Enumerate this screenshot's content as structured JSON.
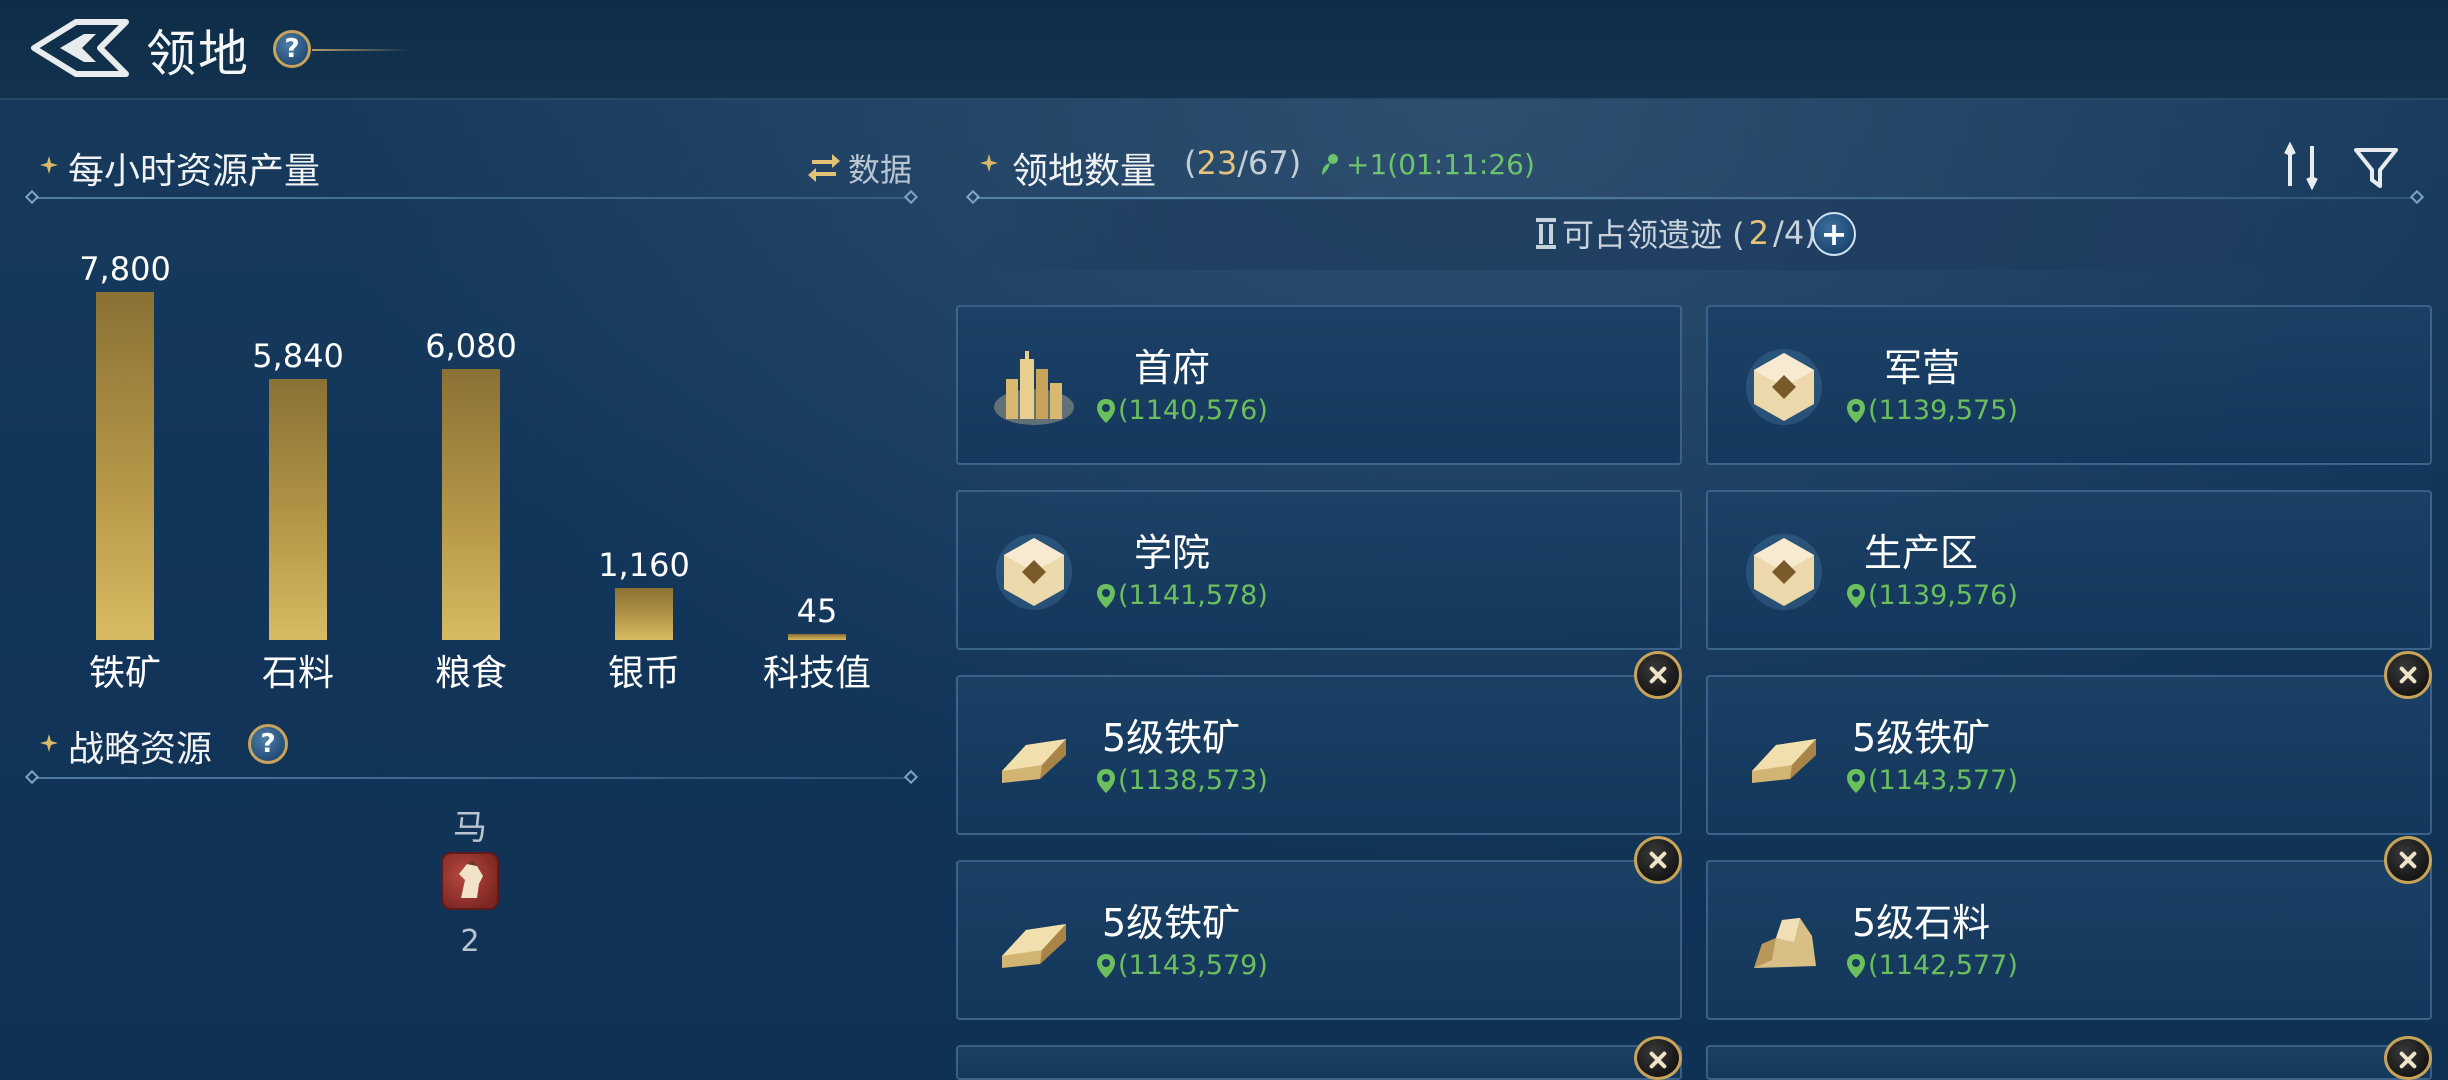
{
  "header": {
    "title": "领地"
  },
  "production": {
    "title": "每小时资源产量",
    "data_label": "数据"
  },
  "chart_data": {
    "type": "bar",
    "categories": [
      "铁矿",
      "石料",
      "粮食",
      "银币",
      "科技值"
    ],
    "values": [
      7800,
      5840,
      6080,
      1160,
      45
    ],
    "value_labels": [
      "7,800",
      "5,840",
      "6,080",
      "1,160",
      "45"
    ],
    "bar_color": "#c4a552"
  },
  "strategic": {
    "title": "战略资源",
    "horse_name": "马",
    "horse_count": "2"
  },
  "territory": {
    "title": "领地数量",
    "paren_open": "(",
    "current": "23",
    "separator": "/",
    "max": "67",
    "paren_close": ")",
    "timer": "+1(01:11:26)",
    "ruins_label": "可占领遗迹 (",
    "ruins_current": "2",
    "ruins_rest": "/4)"
  },
  "cards": [
    {
      "name": "首府",
      "coord": "(1140,576)",
      "icon": "city-icon",
      "closable": false
    },
    {
      "name": "军营",
      "coord": "(1139,575)",
      "icon": "hexagon-building-icon",
      "closable": false
    },
    {
      "name": "学院",
      "coord": "(1141,578)",
      "icon": "hexagon-building-icon",
      "closable": false
    },
    {
      "name": "生产区",
      "coord": "(1139,576)",
      "icon": "hexagon-building-icon",
      "closable": false
    },
    {
      "name": "5级铁矿",
      "coord": "(1138,573)",
      "icon": "iron-ingot-icon",
      "closable": true
    },
    {
      "name": "5级铁矿",
      "coord": "(1143,577)",
      "icon": "iron-ingot-icon",
      "closable": true
    },
    {
      "name": "5级铁矿",
      "coord": "(1143,579)",
      "icon": "iron-ingot-icon",
      "closable": true
    },
    {
      "name": "5级石料",
      "coord": "(1142,577)",
      "icon": "stone-icon",
      "closable": true
    }
  ]
}
